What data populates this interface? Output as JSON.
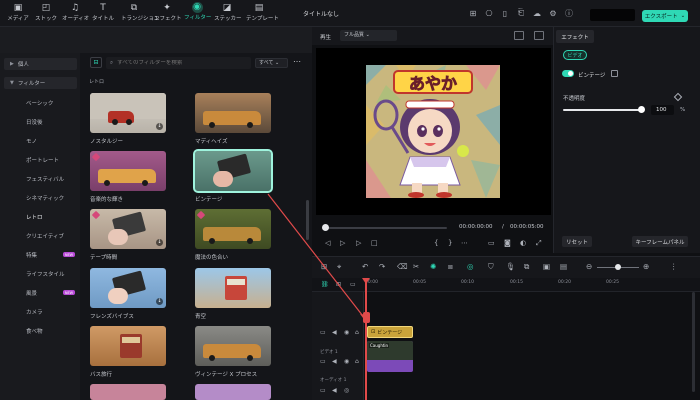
{
  "titlebar": {
    "title": "タイトルなし",
    "export_label": "エクスポート"
  },
  "toolbar": {
    "tabs": [
      "メディア",
      "ストック",
      "オーディオ",
      "タイトル",
      "トランジション",
      "エフェクト",
      "フィルター",
      "ステッカー",
      "テンプレート"
    ]
  },
  "sidebar": {
    "items": [
      {
        "label": "個人",
        "type": "header",
        "expanded": false
      },
      {
        "label": "フィルター",
        "type": "header",
        "expanded": true
      },
      {
        "label": "ベーシック"
      },
      {
        "label": "日没後"
      },
      {
        "label": "モノ"
      },
      {
        "label": "ポートレート"
      },
      {
        "label": "フェスティバル"
      },
      {
        "label": "シネマティック"
      },
      {
        "label": "レトロ",
        "selected": true
      },
      {
        "label": "クリエイティブ"
      },
      {
        "label": "特集",
        "badge": "NEW"
      },
      {
        "label": "ライフスタイル"
      },
      {
        "label": "風景",
        "badge": "NEW"
      },
      {
        "label": "カメラ"
      },
      {
        "label": "食べ物"
      }
    ]
  },
  "search": {
    "placeholder": "すべてのフィルターを検索",
    "sort": "すべて"
  },
  "category": "レトロ",
  "filters": [
    {
      "name": "ノスタルジー"
    },
    {
      "name": "マディヘイズ"
    },
    {
      "name": "音楽的な輝き"
    },
    {
      "name": "ビンテージ",
      "selected": true
    },
    {
      "name": "テープ時間"
    },
    {
      "name": "魔法の色合い"
    },
    {
      "name": "フレンズバイブス"
    },
    {
      "name": "青空"
    },
    {
      "name": "バス旅行"
    },
    {
      "name": "ヴィンテージ X プロセス"
    }
  ],
  "preview": {
    "label": "再生",
    "quality": "フル品質",
    "art_text": "あやか",
    "current_time": "00:00:00:00",
    "separator": "/",
    "total_time": "00:00:05:00"
  },
  "properties": {
    "tab": "エフェクト",
    "chip": "ビデオ",
    "effect_name": "ビンテージ",
    "enabled": true,
    "opacity_label": "不透明度",
    "opacity_value": "100",
    "opacity_unit": "%",
    "reset_label": "リセット",
    "keyframe_label": "キーフレームパネル"
  },
  "timeline": {
    "ruler": [
      "00:00",
      "00:05",
      "00:10",
      "00:15",
      "00:20",
      "00:25"
    ],
    "tracks": [
      {
        "name": "ビデオ 1"
      },
      {
        "name": "オーディオ 1"
      }
    ],
    "effect_clip": "ビンテージ",
    "video_clip": "Caughtin"
  },
  "colors": {
    "accent": "#2fd8b5",
    "playhead": "#e04a4a",
    "effect_clip": "#c9a33a",
    "video_clip": "#7c4ab8"
  }
}
